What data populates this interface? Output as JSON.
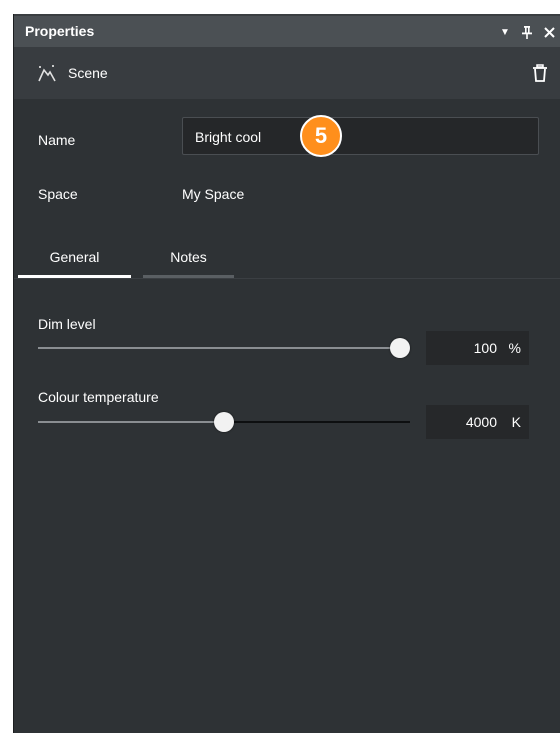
{
  "panel": {
    "title": "Properties",
    "titlebar_icons": {
      "dropdown": "▼",
      "pin": "📌",
      "close": "✕"
    },
    "header": {
      "icon": "scene-icon",
      "label": "Scene"
    },
    "name": {
      "label": "Name",
      "value": "Bright cool",
      "badge": "5"
    },
    "space": {
      "label": "Space",
      "value": "My Space"
    },
    "tabs": [
      {
        "label": "General",
        "active": true
      },
      {
        "label": "Notes",
        "active": false
      }
    ],
    "dim": {
      "label": "Dim level",
      "value": "100",
      "unit": "%",
      "fraction": 1.0
    },
    "colour": {
      "label": "Colour temperature",
      "value": "4000",
      "unit": "K",
      "fraction": 0.5
    }
  },
  "colors": {
    "accent_tab": "#ffffff",
    "inactive_tab": "#5a5f63",
    "badge": "#ff8f1c"
  }
}
